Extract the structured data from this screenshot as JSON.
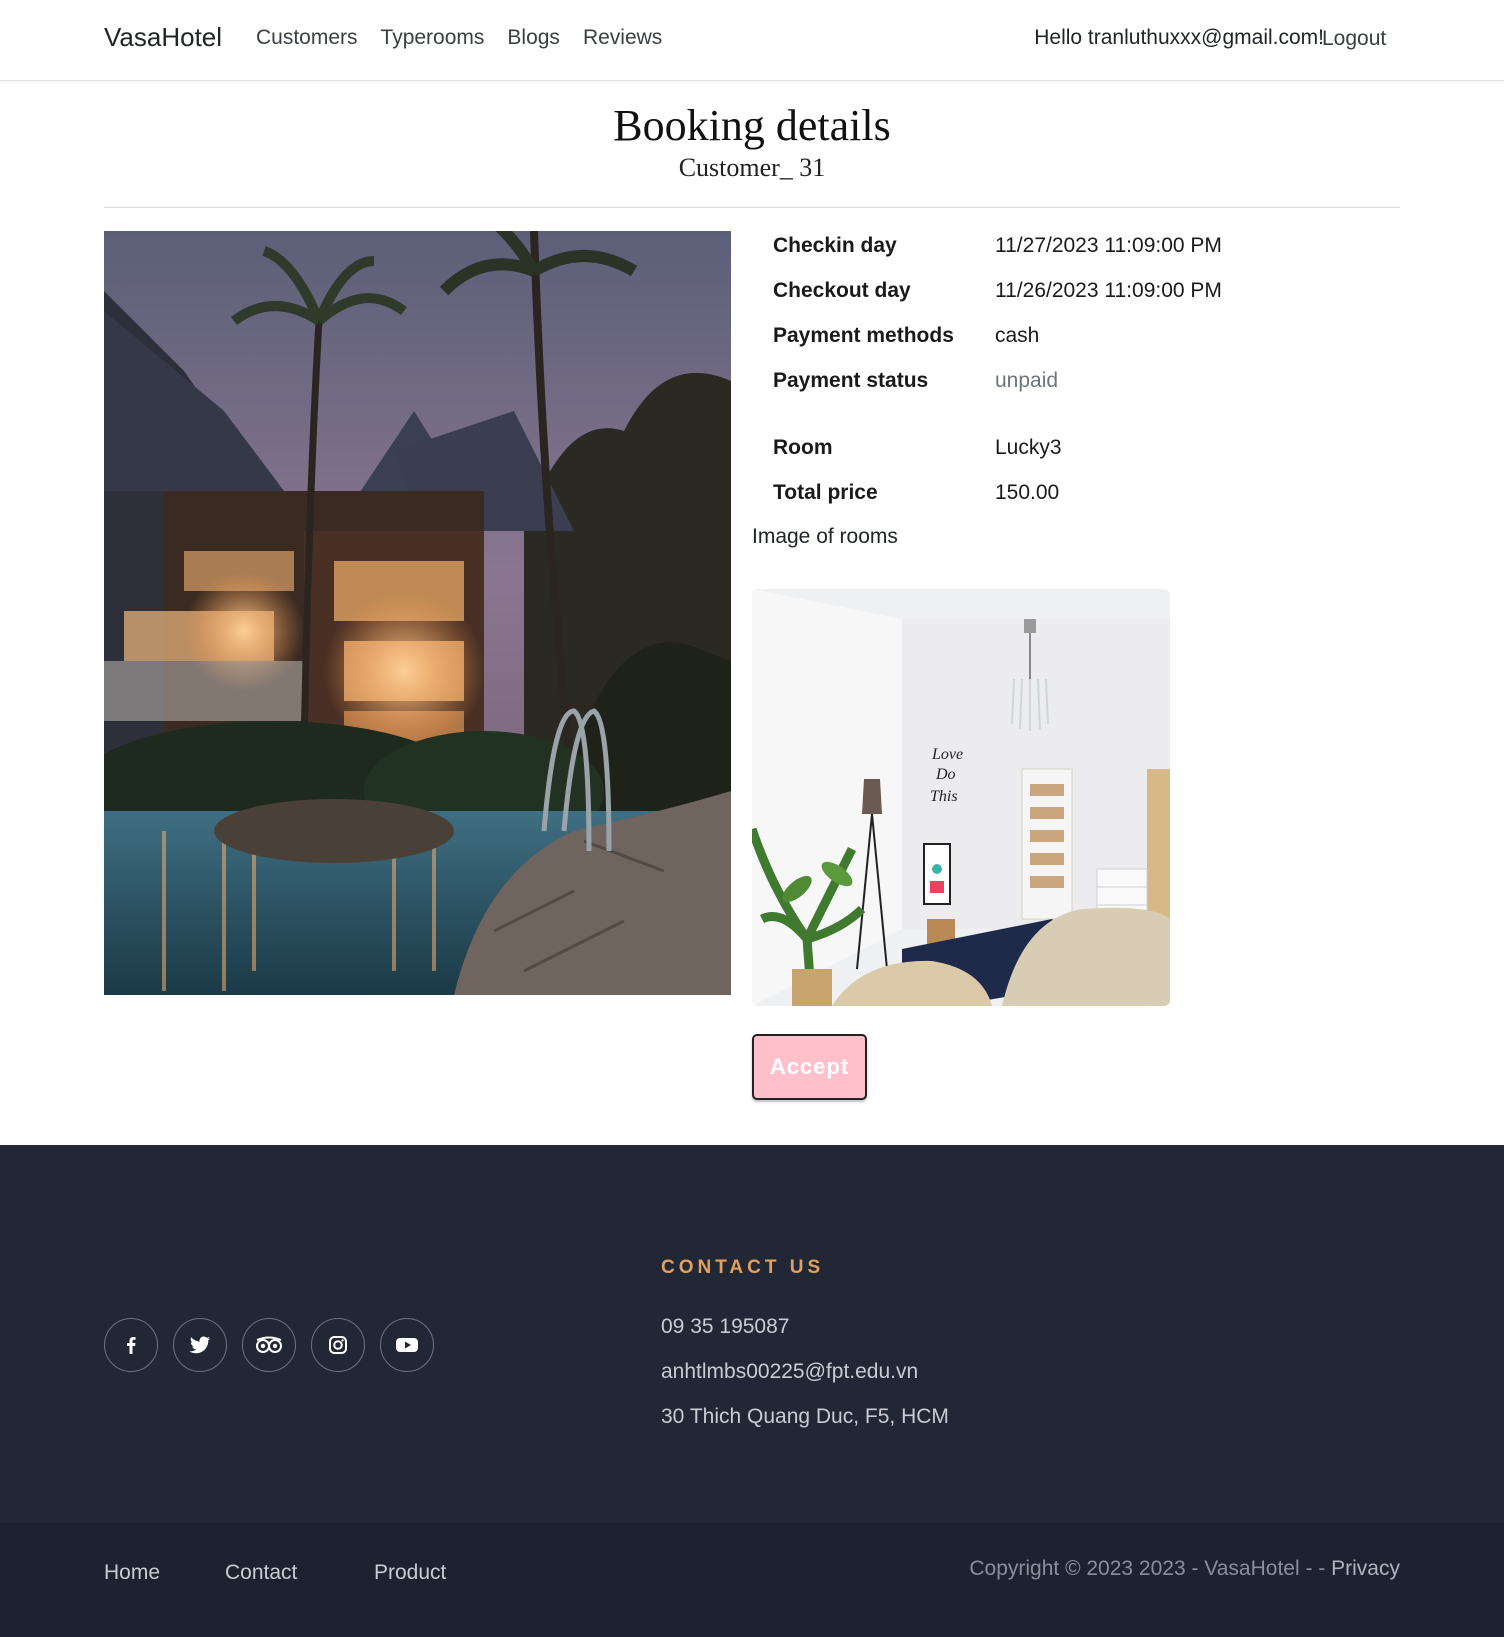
{
  "navbar": {
    "brand": "VasaHotel",
    "links": [
      "Customers",
      "Typerooms",
      "Blogs",
      "Reviews"
    ],
    "greeting": "Hello tranluthuxxx@gmail.com!",
    "logout": "Logout"
  },
  "header": {
    "title": "Booking details",
    "subtitle": "Customer_ 31"
  },
  "details": {
    "checkin_label": "Checkin day",
    "checkin_value": "11/27/2023 11:09:00 PM",
    "checkout_label": "Checkout day",
    "checkout_value": "11/26/2023 11:09:00 PM",
    "payment_method_label": "Payment methods",
    "payment_method_value": "cash",
    "payment_status_label": "Payment status",
    "payment_status_value": "unpaid",
    "room_label": "Room",
    "room_value": "Lucky3",
    "total_label": "Total price",
    "total_value": "150.00",
    "rooms_image_label": "Image of rooms"
  },
  "actions": {
    "accept": "Accept",
    "accept_bg": "#ffc0cb"
  },
  "footer": {
    "socials": [
      "facebook-icon",
      "twitter-icon",
      "tripadvisor-icon",
      "instagram-icon",
      "youtube-icon"
    ],
    "contact_heading": "CONTACT US",
    "phone": "09 35 195087",
    "email": "anhtlmbs00225@fpt.edu.vn",
    "address": "30 Thich Quang Duc, F5, HCM",
    "bottom_links": [
      "Home",
      "Contact",
      "Product"
    ],
    "copyright": "Copyright © 2023 2023 - VasaHotel - -",
    "privacy": "Privacy",
    "accent": "#e0a15f",
    "background": "#222736"
  }
}
